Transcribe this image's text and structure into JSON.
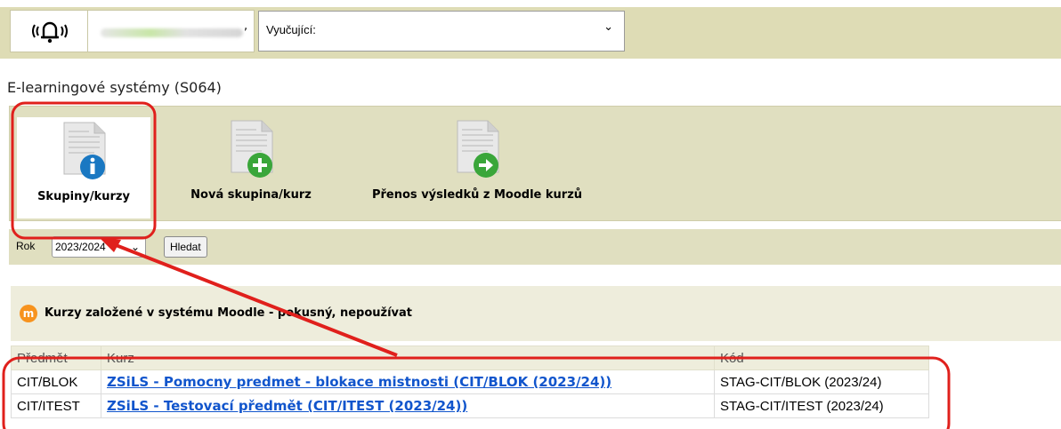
{
  "topbar": {
    "user_separator": ",",
    "role_select": {
      "value": "Vyučující:"
    }
  },
  "page": {
    "title": "E-learningové systémy (S064)"
  },
  "toolbar": {
    "items": [
      {
        "label": "Skupiny/kurzy",
        "icon": "document-info-icon",
        "accent": "#1a78c2"
      },
      {
        "label": "Nová skupina/kurz",
        "icon": "document-add-icon",
        "accent": "#3aa63a"
      },
      {
        "label": "Přenos výsledků z Moodle kurzů",
        "icon": "document-arrow-icon",
        "accent": "#3aa63a"
      }
    ]
  },
  "filter": {
    "year_label": "Rok",
    "year_value": "2023/2024",
    "search_button": "Hledat"
  },
  "section": {
    "title": "Kurzy založené v systému Moodle - pokusný, nepoužívat",
    "logo_letter": "m",
    "logo_color": "#f7931e"
  },
  "table": {
    "headers": [
      "Předmět",
      "Kurz",
      "Kód"
    ],
    "rows": [
      {
        "predmet": "CIT/BLOK",
        "kurz": "ZSiLS - Pomocny predmet - blokace mistnosti (CIT/BLOK (2023/24))",
        "kod": "STAG-CIT/BLOK (2023/24)"
      },
      {
        "predmet": "CIT/ITEST",
        "kurz": "ZSiLS - Testovací předmět (CIT/ITEST (2023/24))",
        "kod": "STAG-CIT/ITEST (2023/24)"
      }
    ]
  },
  "annotation_color": "#e0201c"
}
